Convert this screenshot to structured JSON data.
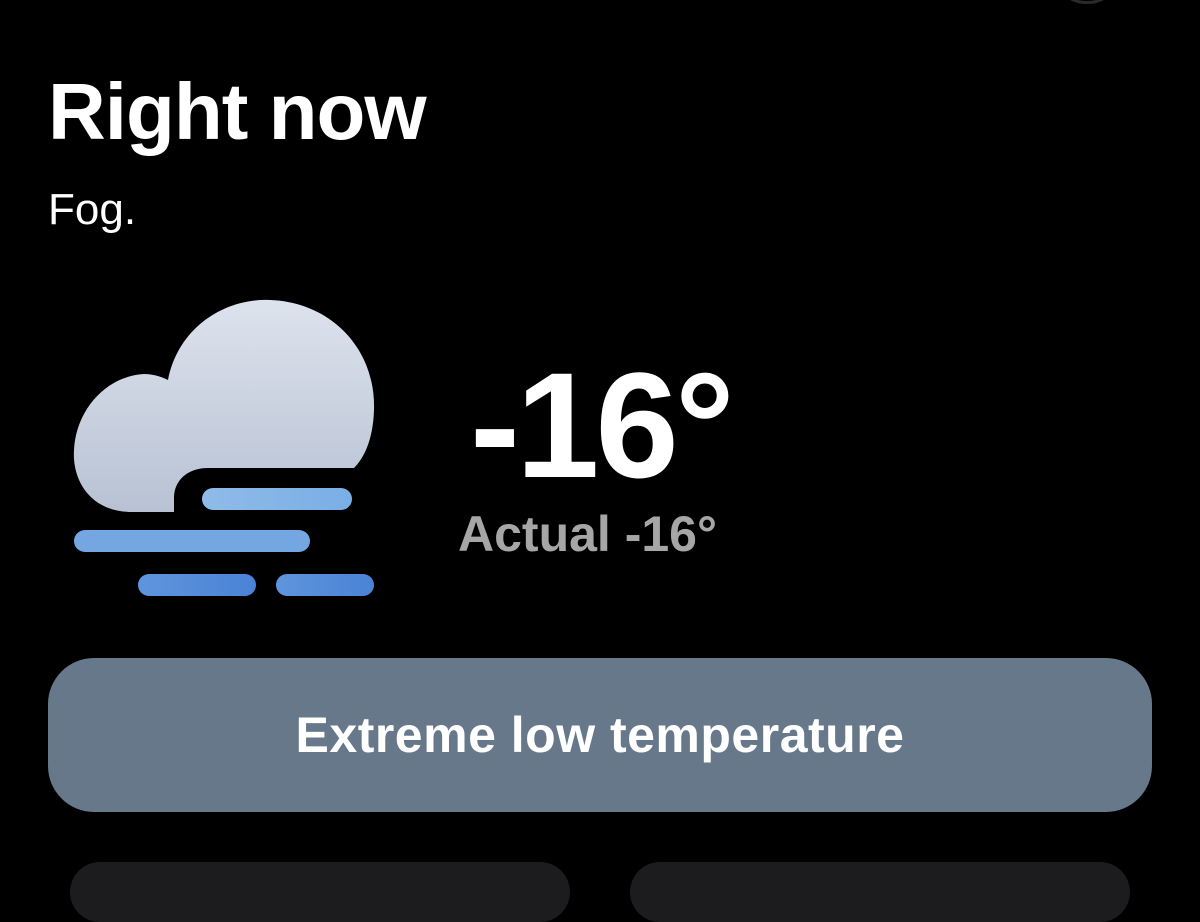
{
  "header": {
    "title": "Right now",
    "condition": "Fog."
  },
  "current": {
    "icon": "fog-cloud-icon",
    "temperature": "-16°",
    "actual": "Actual -16°"
  },
  "alert": {
    "label": "Extreme low temperature",
    "color": "#66788a"
  }
}
